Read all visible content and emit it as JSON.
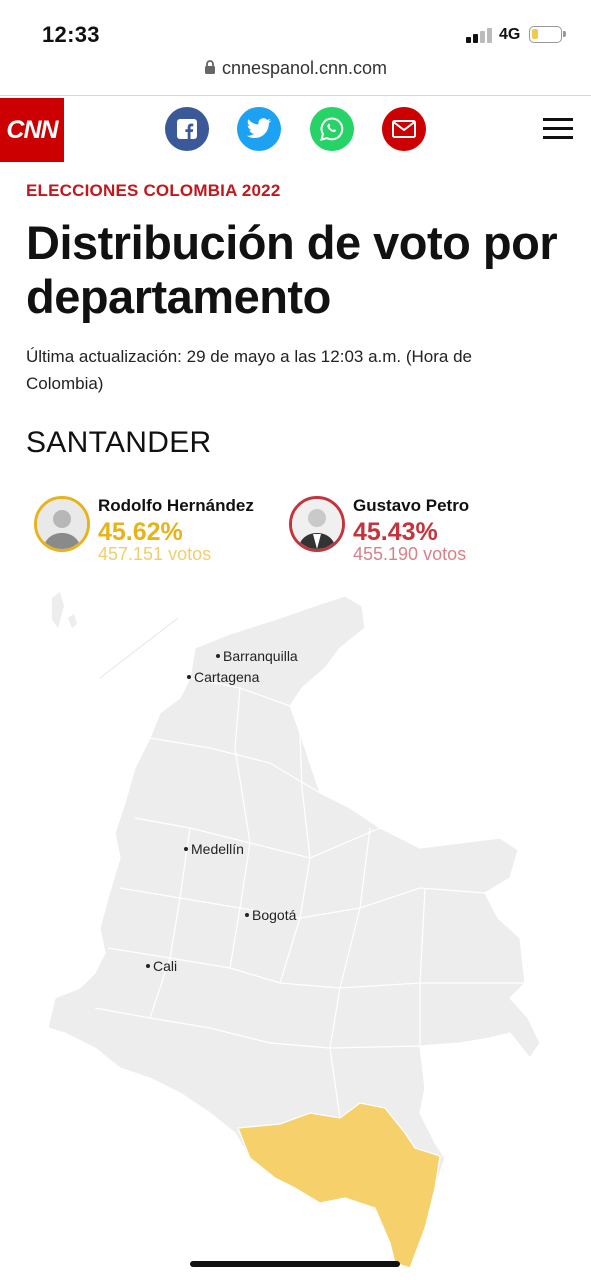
{
  "status_bar": {
    "time": "12:33",
    "network": "4G",
    "signal_bars": 2,
    "battery_level": 0.22,
    "battery_color": "#f2c94c"
  },
  "browser": {
    "url": "cnnespanol.cnn.com"
  },
  "header": {
    "logo_text": "CNN",
    "share_icons": [
      "facebook-icon",
      "twitter-icon",
      "whatsapp-icon",
      "email-icon"
    ],
    "menu_icon": "hamburger-menu-icon"
  },
  "article": {
    "kicker": "ELECCIONES COLOMBIA 2022",
    "title": "Distribución de voto por departamento",
    "updated": "Última actualización: 29 de mayo a las 12:03 a.m. (Hora de Colombia)",
    "department": "SANTANDER"
  },
  "candidates": [
    {
      "name": "Rodolfo Hernández",
      "percent": "45.62%",
      "votes": "457.151 votos",
      "color": "#e8b21a"
    },
    {
      "name": "Gustavo Petro",
      "percent": "45.43%",
      "votes": "455.190 votos",
      "color": "#c4343d"
    }
  ],
  "map": {
    "cities": [
      "Barranquilla",
      "Cartagena",
      "Medellín",
      "Bogotá",
      "Cali"
    ],
    "base_color": "#ededed",
    "highlight_color": "#f6d06a"
  }
}
